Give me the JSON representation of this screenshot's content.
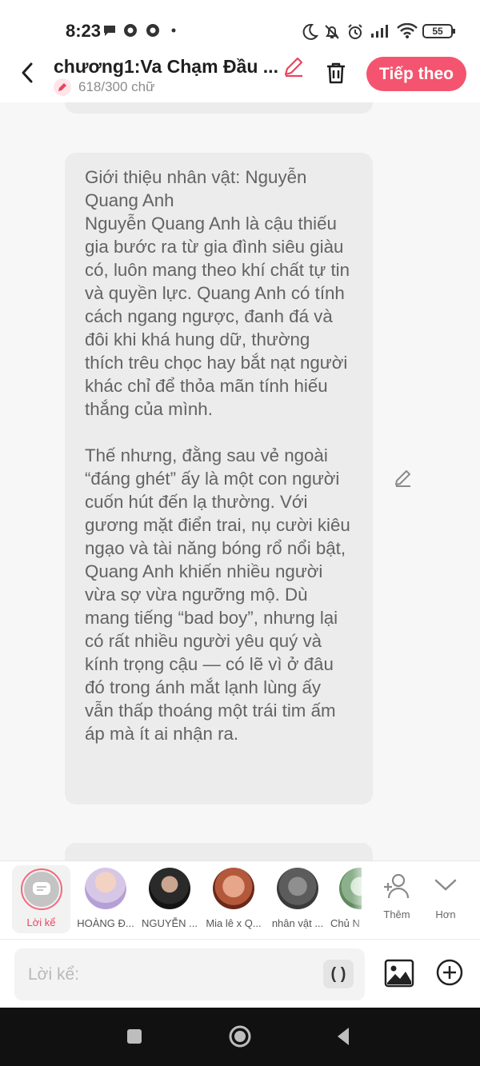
{
  "status_bar": {
    "time": "8:23",
    "battery": "55"
  },
  "header": {
    "title": "chương1:Va Chạm Đầu ...",
    "word_count": "618/300 chữ",
    "next_label": "Tiếp theo",
    "accent_color": "#f4546f"
  },
  "message": {
    "text": "Giới thiệu nhân vật: Nguyễn Quang Anh\nNguyễn Quang Anh là cậu thiếu gia bước ra từ gia đình siêu giàu có, luôn mang theo khí chất tự tin và quyền lực. Quang Anh có tính cách ngang ngược, đanh đá và đôi khi khá hung dữ, thường thích trêu chọc hay bắt nạt người khác chỉ để thỏa mãn tính hiếu thắng của mình.\n\nThế nhưng, đằng sau vẻ ngoài “đáng ghét” ấy là một con người cuốn hút đến lạ thường. Với gương mặt điển trai, nụ cười kiêu ngạo và tài năng bóng rổ nổi bật, Quang Anh khiến nhiều người vừa sợ vừa ngưỡng mộ. Dù mang tiếng “bad boy”, nhưng lại có rất nhiều người yêu quý và kính trọng cậu — có lẽ vì ở đâu đó trong ánh mắt lạnh lùng ấy vẫn thấp thoáng một trái tim ấm áp mà ít ai nhận ra."
  },
  "characters": {
    "narrator_label": "Lời kể",
    "items": [
      {
        "name": "HOÀNG Đ..."
      },
      {
        "name": "NGUYỄN ..."
      },
      {
        "name": "Mia lê x Q..."
      },
      {
        "name": "nhân vật ..."
      },
      {
        "name": "Chủ N"
      }
    ],
    "add_label": "Thêm",
    "more_label": "Hơn"
  },
  "input": {
    "placeholder": "Lời kể:",
    "paren_label": "( )"
  }
}
